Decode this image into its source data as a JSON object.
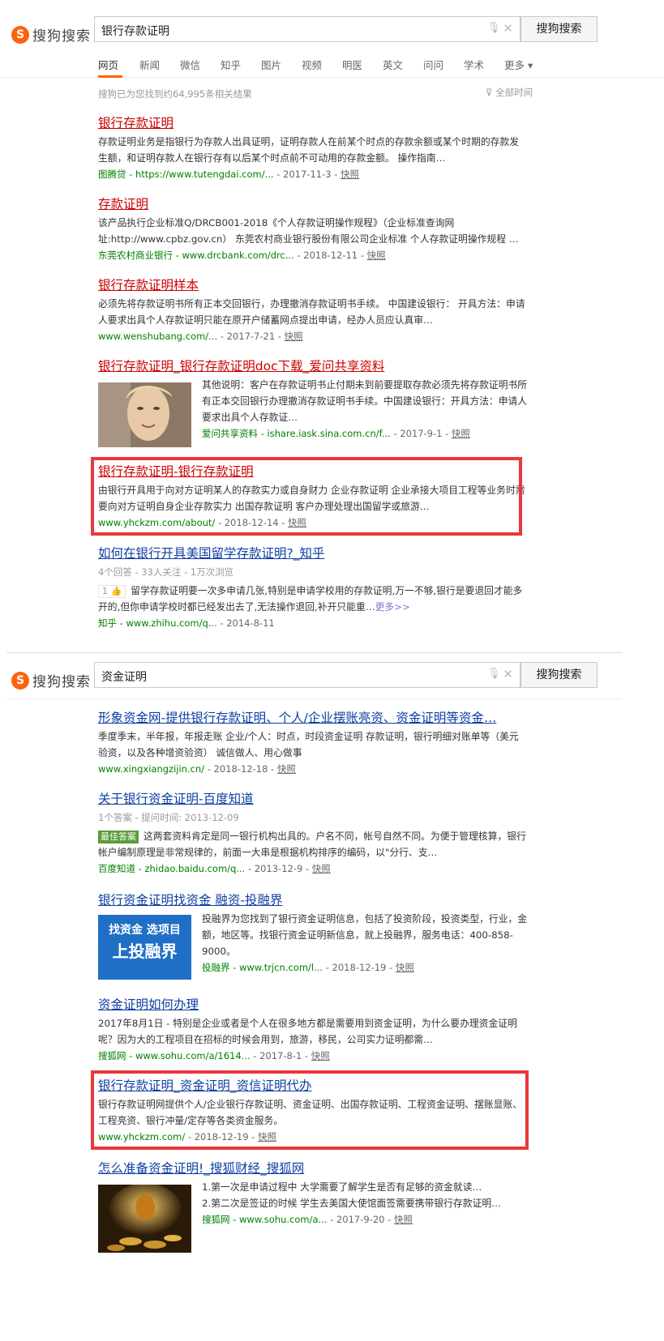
{
  "brand": {
    "logo_letter": "S",
    "name": "搜狗搜索"
  },
  "top": {
    "query": "银行存款证明",
    "button": "搜狗搜索"
  },
  "tabs": [
    "网页",
    "新闻",
    "微信",
    "知乎",
    "图片",
    "视频",
    "明医",
    "英文",
    "问问",
    "学术",
    "更多 ▾"
  ],
  "stats": "搜狗已为您找到约64,995条相关结果",
  "time_filter": "全部时间",
  "results1": [
    {
      "title": "银行存款证明",
      "desc": "存款证明业务是指银行为存款人出具证明，证明存款人在前某个时点的存款余额或某个时期的存款发生额，和证明存款人在银行存有以后某个时点前不可动用的存款金额。 操作指南…",
      "url": "图腾贷 - https://www.tutengdai.com/...",
      "date": "- 2017-11-3 -",
      "snap": "快照"
    },
    {
      "title": "存款证明",
      "desc": "该产品执行企业标准Q/DRCB001-2018《个人存款证明操作规程》（企业标准查询网址:http://www.cpbz.gov.cn） 东莞农村商业银行股份有限公司企业标准 个人存款证明操作规程 …",
      "url": "东莞农村商业银行 - www.drcbank.com/drc...",
      "date": "- 2018-12-11 -",
      "snap": "快照"
    },
    {
      "title": "银行存款证明样本",
      "desc": "必须先将存款证明书所有正本交回银行，办理撤消存款证明书手续。 中国建设银行： 开具方法：申请人要求出具个人存款证明只能在原开户储蓄网点提出申请，经办人员应认真审…",
      "url": "www.wenshubang.com/...",
      "date": "- 2017-7-21 -",
      "snap": "快照"
    },
    {
      "title": "银行存款证明_银行存款证明doc下载_爱问共享资料",
      "desc": "其他说明：客户在存款证明书止付期未到前要提取存款必须先将存款证明书所有正本交回银行办理撤消存款证明书手续。中国建设银行：开具方法：申请人要求出具个人存款证…",
      "url": "爱问共享资料 - ishare.iask.sina.com.cn/f...",
      "date": "- 2017-9-1 -",
      "snap": "快照"
    },
    {
      "title": "银行存款证明-银行存款证明",
      "desc": "由银行开具用于向对方证明某人的存款实力或自身财力 企业存款证明 企业承接大项目工程等业务时需要向对方证明自身企业存款实力 出国存款证明 客户办理处理出国留学或旅游…",
      "url": "www.yhckzm.com/about/",
      "date": "- 2018-12-14 -",
      "snap": "快照"
    },
    {
      "title": "如何在银行开具美国留学存款证明?_知乎",
      "meta": "4个回答 - 33人关注 - 1万次浏览",
      "vote": "1 👍",
      "desc": "留学存款证明要一次多申请几张,特别是申请学校用的存款证明,万一不够,银行是要退回才能多开的,但你申请学校时都已经发出去了,无法操作退回,补开只能重…",
      "more": "更多>>",
      "url": "知乎 - www.zhihu.com/q...",
      "date": "- 2014-8-11"
    }
  ],
  "bottom": {
    "query": "资金证明",
    "button": "搜狗搜索"
  },
  "results2": [
    {
      "title": "形象资金网-提供银行存款证明、个人/企业摆账亮资、资金证明等资金…",
      "desc": "季度季末，半年报，年报走账 企业/个人：时点，时段资金证明 存款证明，银行明细对账单等（美元验资，以及各种增资验资） 诚信做人、用心做事",
      "url": "www.xingxiangzijin.cn/",
      "date": "- 2018-12-18 -",
      "snap": "快照"
    },
    {
      "title": "关于银行资金证明-百度知道",
      "meta": "1个答案 - 提问时间: 2013-12-09",
      "badge": "最佳答案",
      "desc": "这两套资料肯定是同一银行机构出具的。户名不同，帐号自然不同。为便于管理核算，银行帐户编制原理是非常规律的，前面一大串是根据机构排序的编码，以\"分行、支…",
      "url": "百度知道 - zhidao.baidu.com/q...",
      "date": "- 2013-12-9 -",
      "snap": "快照"
    },
    {
      "title": "银行资金证明找资金 融资-投融界",
      "img_line1": "找资金 选项目",
      "img_line2": "上投融界",
      "desc": "投融界为您找到了银行资金证明信息，包括了投资阶段，投资类型，行业，金额，地区等。找银行资金证明新信息，就上投融界，服务电话：400-858-9000。",
      "url": "投融界 - www.trjcn.com/l...",
      "date": "- 2018-12-19 -",
      "snap": "快照"
    },
    {
      "title": "资金证明如何办理",
      "desc": "2017年8月1日 - 特别是企业或者是个人在很多地方都是需要用到资金证明，为什么要办理资金证明呢？因为大的工程项目在招标的时候会用到，旅游，移民，公司实力证明都需…",
      "url": "搜狐网 - www.sohu.com/a/1614...",
      "date": "- 2017-8-1 -",
      "snap": "快照"
    },
    {
      "title": "银行存款证明_资金证明_资信证明代办",
      "desc": "银行存款证明网提供个人/企业银行存款证明、资金证明、出国存款证明、工程资金证明、摆账显账、工程亮资、银行冲量/定存等各类资金服务。",
      "url": "www.yhckzm.com/",
      "date": "- 2018-12-19 -",
      "snap": "快照"
    },
    {
      "title": "怎么准备资金证明!_搜狐财经_搜狐网",
      "desc1": "1.第一次是申请过程中 大学需要了解学生是否有足够的资金就读…",
      "desc2": "2.第二次是签证的时候 学生去美国大使馆面签需要携带银行存款证明…",
      "url": "搜狐网 - www.sohu.com/a...",
      "date": "- 2017-9-20 -",
      "snap": "快照"
    }
  ]
}
